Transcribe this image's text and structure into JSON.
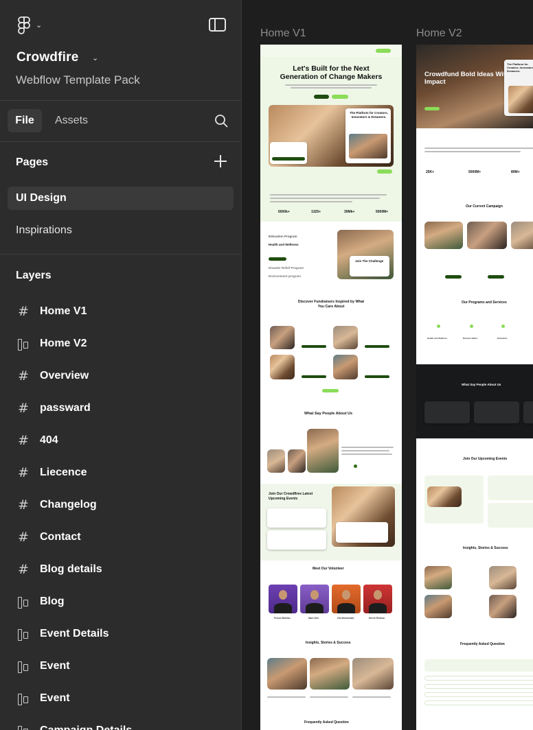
{
  "app": {
    "project_name": "Crowdfire",
    "project_subtitle": "Webflow Template Pack"
  },
  "tabs": {
    "file": "File",
    "assets": "Assets"
  },
  "pages": {
    "title": "Pages",
    "items": [
      "UI Design",
      "Inspirations"
    ],
    "active": "UI Design"
  },
  "layers": {
    "title": "Layers",
    "items": [
      {
        "label": "Home V1",
        "icon": "frame-hash-icon"
      },
      {
        "label": "Home V2",
        "icon": "section-icon"
      },
      {
        "label": "Overview",
        "icon": "frame-hash-icon"
      },
      {
        "label": "passward",
        "icon": "frame-hash-icon"
      },
      {
        "label": "404",
        "icon": "frame-hash-icon"
      },
      {
        "label": "Liecence",
        "icon": "frame-hash-icon"
      },
      {
        "label": "Changelog",
        "icon": "frame-hash-icon"
      },
      {
        "label": "Contact",
        "icon": "frame-hash-icon"
      },
      {
        "label": "Blog details",
        "icon": "frame-hash-icon"
      },
      {
        "label": "Blog",
        "icon": "section-icon"
      },
      {
        "label": "Event Details",
        "icon": "section-icon"
      },
      {
        "label": "Event",
        "icon": "section-icon"
      },
      {
        "label": "Event",
        "icon": "section-icon"
      },
      {
        "label": "Campaign Details",
        "icon": "section-icon"
      }
    ]
  },
  "canvas": {
    "frames": [
      {
        "label": "Home V1",
        "hero_title": "Let's Built for the Next Generation of Change Makers",
        "hero_card_title": "The Platform for Creators, Innovators & Dreamers.",
        "stats": [
          "6000k+",
          "1325+",
          "30Mk+",
          "5000M+"
        ],
        "programs_heading": "Education Program",
        "program_items": [
          "Health and Wellness",
          "Disaster Relief Program",
          "Environment program"
        ],
        "challenge_card": "Join The Challenge",
        "fundraisers_heading": "Discover Fundraisers Inspired by What You Care About",
        "testimonials_heading": "What Say People About Us",
        "events_heading": "Join Our Crowdfires Latest Upcoming Events",
        "volunteer_heading": "Meet Our Volunteer",
        "volunteers": [
          "Person Badrian",
          "Mark Zain",
          "Zilo Mohammad",
          "Hiresh Reamon"
        ],
        "insights_heading": "Insights, Stories & Success",
        "faq_heading": "Frequently Asked Question"
      },
      {
        "label": "Home V2",
        "hero_title": "Crowdfund Bold Ideas With Real Impact",
        "hero_card_title": "The Platform for Creators, Innovators & Dreamers.",
        "stats": [
          "25K+",
          "5000M+",
          "80M+"
        ],
        "campaign_heading": "Our Current Campaign",
        "programs_heading": "Our Programs and Services",
        "program_items": [
          "Health and Wellness",
          "Disaster Relief",
          "Education"
        ],
        "testimonials_heading": "What Say People About Us",
        "events_heading": "Join Our Upcoming Events",
        "insights_heading": "Insights, Stories & Success",
        "faq_heading": "Frequently Asked Question"
      }
    ]
  },
  "colors": {
    "sidebar_bg": "#2c2c2c",
    "canvas_bg": "#1e1e1e",
    "accent_green": "#8bdc58",
    "dark_green": "#1f4d0f"
  }
}
